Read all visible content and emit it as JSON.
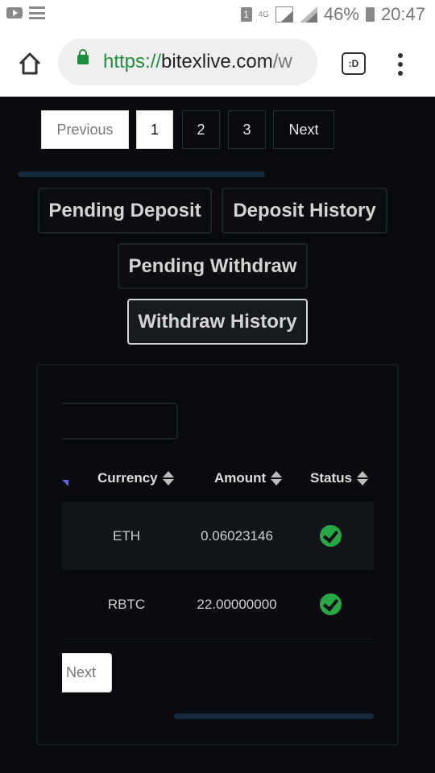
{
  "status_bar": {
    "sim_slot": "1",
    "network": "4G",
    "battery": "46%",
    "time": "20:47"
  },
  "browser": {
    "url_scheme": "https://",
    "url_host": "bitexlive.com",
    "url_rest": "/w",
    "tab_switcher_label": ":D"
  },
  "pagination_top": {
    "previous": "Previous",
    "pages": [
      "1",
      "2",
      "3"
    ],
    "active_page": "1",
    "next": "Next"
  },
  "tabs": {
    "pending_deposit": "Pending Deposit",
    "deposit_history": "Deposit History",
    "pending_withdraw": "Pending Withdraw",
    "withdraw_history": "Withdraw History",
    "active": "Withdraw History"
  },
  "table": {
    "columns": {
      "currency": "Currency",
      "amount": "Amount",
      "status": "Status"
    },
    "rows": [
      {
        "currency": "ETH",
        "amount": "0.06023146",
        "status": "check-icon"
      },
      {
        "currency": "RBTC",
        "amount": "22.00000000",
        "status": "check-icon"
      }
    ],
    "next_label": "Next"
  },
  "colors": {
    "page_bg": "#090b0e",
    "success": "#28a745",
    "url_green": "#1e8e3e",
    "sort_accent": "#5a64d8"
  }
}
